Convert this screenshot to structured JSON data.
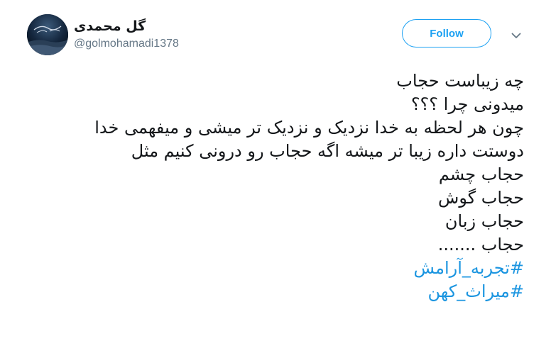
{
  "tweet": {
    "display_name": "گل محمدی",
    "username": "@golmohamadi1378",
    "follow_label": "Follow",
    "avatar_icon": "avatar-image",
    "menu_icon": "chevron-down-icon",
    "lines": [
      "چه زیباست حجاب",
      "میدونی چرا ؟؟؟",
      "چون هر لحظه به خدا نزدیک و نزدیک تر میشی و میفهمی خدا",
      "دوستت داره زیبا تر میشه اگه حجاب رو درونی کنیم مثل",
      "حجاب چشم",
      "حجاب گوش",
      "حجاب زبان",
      "حجاب ......."
    ],
    "hashtags": [
      {
        "hash": "#",
        "text": "تجربه_آرامش"
      },
      {
        "hash": "#",
        "text": "میراث_کهن"
      }
    ]
  },
  "colors": {
    "link": "#1b95e0",
    "follow_border": "#1da1f2",
    "secondary_text": "#657786",
    "primary_text": "#14171a"
  }
}
